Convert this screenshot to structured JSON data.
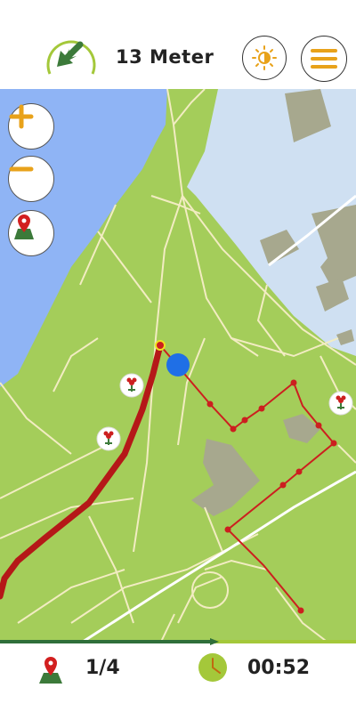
{
  "header": {
    "distance_text": "13 Meter",
    "direction_icon": "arrow-down-left-icon",
    "brightness_icon": "brightness-icon",
    "menu_icon": "hamburger-menu-icon"
  },
  "map_controls": {
    "zoom_in_icon": "plus-icon",
    "zoom_out_icon": "minus-icon",
    "locate_icon": "map-pin-icon"
  },
  "footer": {
    "station_counter": "1/4",
    "timer": "00:52",
    "station_icon": "map-pin-icon",
    "clock_icon": "clock-icon"
  },
  "progress": {
    "value": 0.6
  },
  "colors": {
    "accent": "#e8a21a",
    "green_dark": "#3c7a3a",
    "green_light": "#a4c83a",
    "map_water": "#8fb4f5",
    "map_park": "#a4cd5a",
    "route": "#cc1f1f",
    "location_dot": "#1f6fe6"
  }
}
